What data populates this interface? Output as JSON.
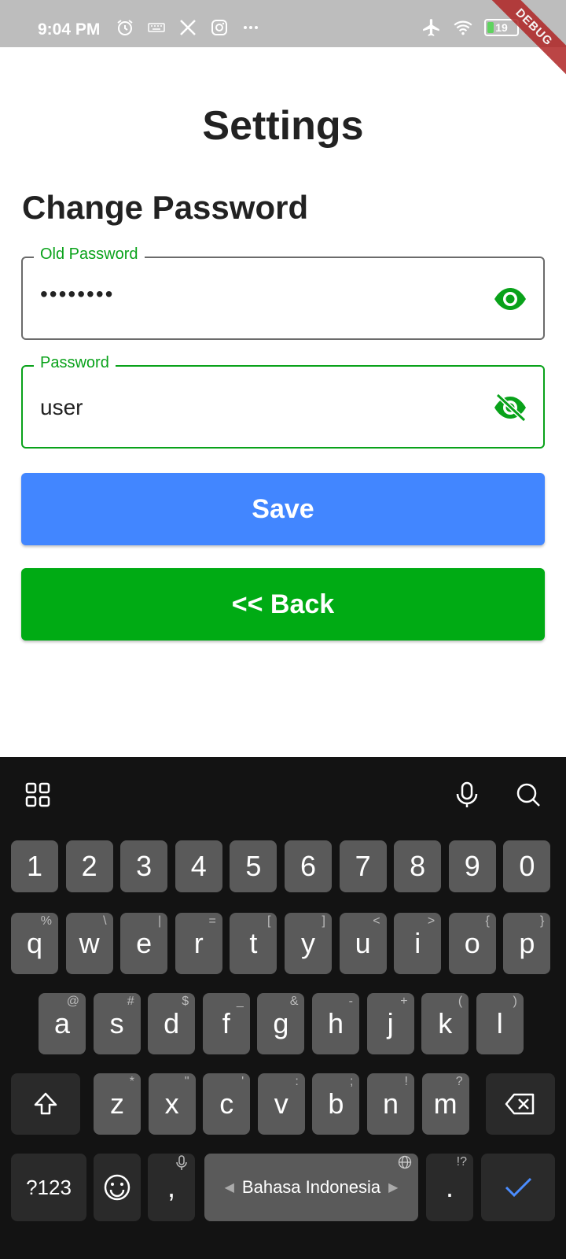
{
  "status_bar": {
    "time": "9:04 PM",
    "battery": "19",
    "debug": "DEBUG",
    "left_icons": [
      "alarm-icon",
      "keyboard-icon",
      "x-logo-icon",
      "instagram-icon",
      "more-icon"
    ],
    "right_icons": [
      "airplane-icon",
      "wifi-icon",
      "battery-icon"
    ]
  },
  "page": {
    "title": "Settings",
    "section_title": "Change Password"
  },
  "form": {
    "old_password": {
      "label": "Old Password",
      "value": "••••••••"
    },
    "password": {
      "label": "Password",
      "value": "user"
    }
  },
  "buttons": {
    "save": "Save",
    "back": "<< Back"
  },
  "colors": {
    "accent_green": "#09a21a",
    "save_blue": "#4286ff",
    "back_green": "#00ab14"
  },
  "keyboard": {
    "number_row": [
      "1",
      "2",
      "3",
      "4",
      "5",
      "6",
      "7",
      "8",
      "9",
      "0"
    ],
    "row1": [
      {
        "key": "q",
        "hint": "%"
      },
      {
        "key": "w",
        "hint": "\\"
      },
      {
        "key": "e",
        "hint": "|"
      },
      {
        "key": "r",
        "hint": "="
      },
      {
        "key": "t",
        "hint": "["
      },
      {
        "key": "y",
        "hint": "]"
      },
      {
        "key": "u",
        "hint": "<"
      },
      {
        "key": "i",
        "hint": ">"
      },
      {
        "key": "o",
        "hint": "{"
      },
      {
        "key": "p",
        "hint": "}"
      }
    ],
    "row2": [
      {
        "key": "a",
        "hint": "@"
      },
      {
        "key": "s",
        "hint": "#"
      },
      {
        "key": "d",
        "hint": "$"
      },
      {
        "key": "f",
        "hint": "_"
      },
      {
        "key": "g",
        "hint": "&"
      },
      {
        "key": "h",
        "hint": "-"
      },
      {
        "key": "j",
        "hint": "+"
      },
      {
        "key": "k",
        "hint": "("
      },
      {
        "key": "l",
        "hint": ")"
      }
    ],
    "row3": [
      {
        "key": "z",
        "hint": "*"
      },
      {
        "key": "x",
        "hint": "\""
      },
      {
        "key": "c",
        "hint": "'"
      },
      {
        "key": "v",
        "hint": ":"
      },
      {
        "key": "b",
        "hint": ";"
      },
      {
        "key": "n",
        "hint": "!"
      },
      {
        "key": "m",
        "hint": "?"
      }
    ],
    "symbols_label": "?123",
    "comma": ",",
    "space_label": "Bahasa Indonesia",
    "period": ".",
    "period_hint": "!?"
  }
}
